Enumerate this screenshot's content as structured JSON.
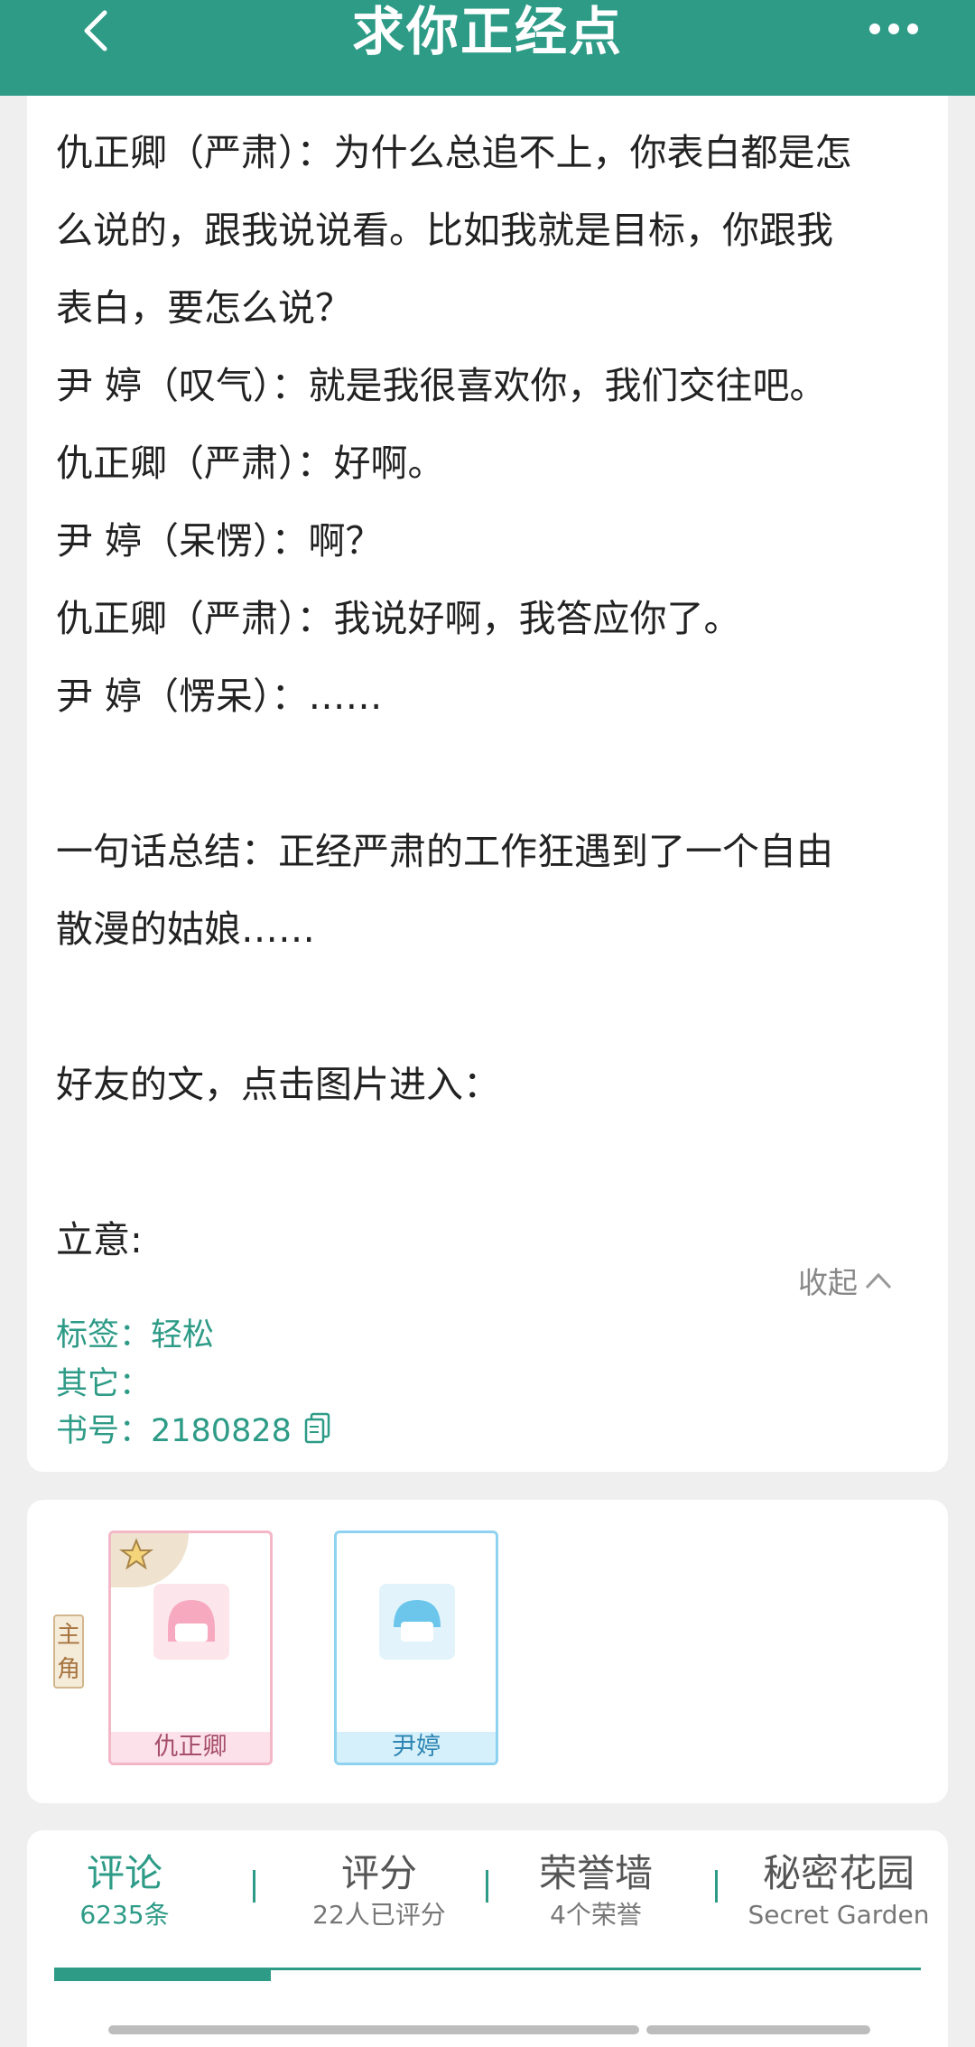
{
  "header": {
    "title": "求你正经点",
    "back_icon": "chevron-left-icon",
    "more_icon": "more-dots-icon"
  },
  "intro": {
    "lines": [
      "仇正卿（严肃）：为什么总追不上，你表白都是怎",
      "么说的，跟我说说看。比如我就是目标，你跟我",
      "表白，要怎么说？",
      "尹  婷（叹气）：就是我很喜欢你，我们交往吧。",
      "仇正卿（严肃）：好啊。",
      "尹  婷（呆愣）：啊？",
      "仇正卿（严肃）：我说好啊，我答应你了。",
      "尹  婷（愣呆）：……",
      "",
      "一句话总结：正经严肃的工作狂遇到了一个自由",
      "散漫的姑娘……",
      "",
      "好友的文，点击图片进入：",
      "",
      "立意:"
    ],
    "collapse_label": "收起",
    "tags_label": "标签：轻松",
    "other_label": "其它：",
    "book_number_label": "书号：2180828"
  },
  "roles": {
    "role_tag": "主角",
    "characters": [
      {
        "name": "仇正卿"
      },
      {
        "name": "尹婷"
      }
    ]
  },
  "tabs": [
    {
      "label": "评论",
      "sub": "6235条",
      "active": true
    },
    {
      "label": "评分",
      "sub": "22人已评分",
      "active": false
    },
    {
      "label": "荣誉墙",
      "sub": "4个荣誉",
      "active": false
    },
    {
      "label": "秘密花园",
      "sub": "Secret Garden",
      "active": false
    }
  ],
  "colors": {
    "accent": "#2e9b87",
    "page_bg": "#efefef"
  }
}
